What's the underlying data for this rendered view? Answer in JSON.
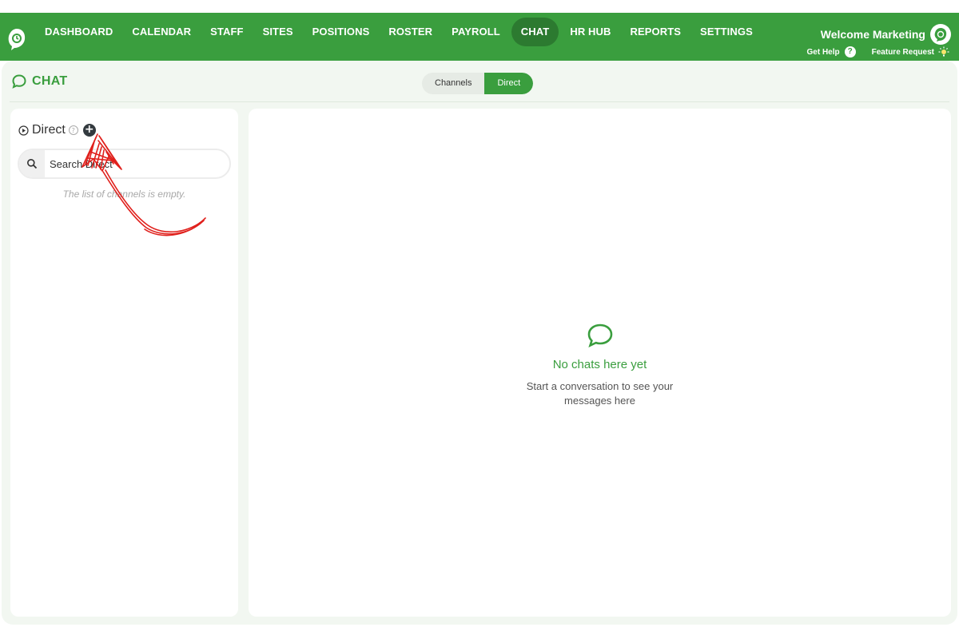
{
  "nav": {
    "items": [
      {
        "label": "DASHBOARD"
      },
      {
        "label": "CALENDAR"
      },
      {
        "label": "STAFF"
      },
      {
        "label": "SITES"
      },
      {
        "label": "POSITIONS"
      },
      {
        "label": "ROSTER"
      },
      {
        "label": "PAYROLL"
      },
      {
        "label": "CHAT"
      },
      {
        "label": "HR HUB"
      },
      {
        "label": "REPORTS"
      },
      {
        "label": "SETTINGS"
      }
    ],
    "active": "CHAT",
    "welcome": "Welcome Marketing",
    "get_help": "Get Help",
    "feature_request": "Feature Request"
  },
  "page": {
    "title": "CHAT",
    "tabs": [
      {
        "label": "Channels"
      },
      {
        "label": "Direct"
      }
    ],
    "active_tab": "Direct"
  },
  "sidebar": {
    "title": "Direct",
    "search_placeholder": "Search Direct",
    "empty_text": "The list of channels is empty."
  },
  "main": {
    "empty_title": "No chats here yet",
    "empty_subtitle": "Start a conversation to see your messages here"
  },
  "colors": {
    "brand_green": "#3a9e3e",
    "active_nav": "#2c7a30",
    "annotation_red": "#e0201c"
  },
  "icons": [
    "logo-icon",
    "chat-bubble-icon",
    "play-circle-icon",
    "help-icon",
    "plus-icon",
    "search-icon",
    "lightbulb-icon"
  ]
}
